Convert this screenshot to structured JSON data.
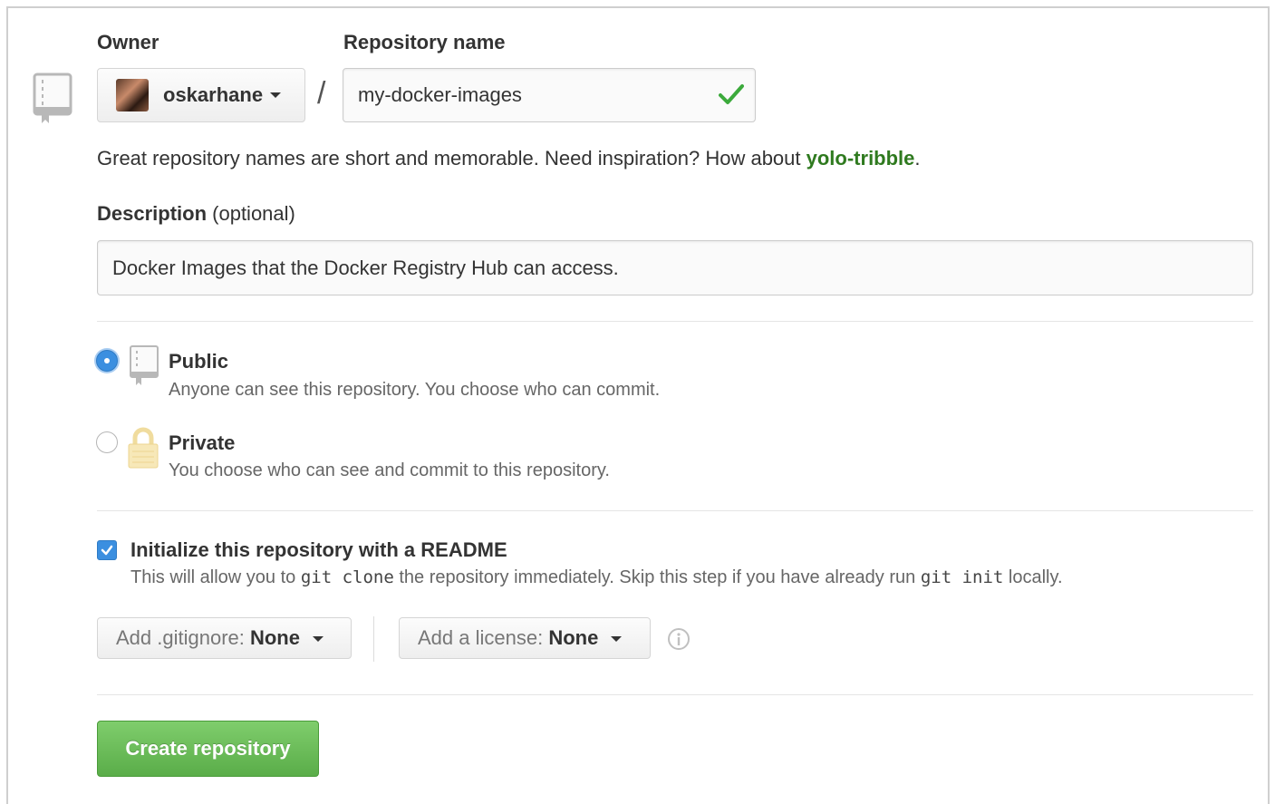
{
  "owner": {
    "label": "Owner",
    "name": "oskarhane",
    "avatar_icon": "user-avatar"
  },
  "repository": {
    "label": "Repository name",
    "separator": "/",
    "value": "my-docker-images",
    "valid_icon": "check-icon"
  },
  "hint": {
    "text": "Great repository names are short and memorable. Need inspiration? How about ",
    "suggestion": "yolo-tribble",
    "end": "."
  },
  "description": {
    "label": "Description",
    "optional": " (optional)",
    "value": "Docker Images that the Docker Registry Hub can access."
  },
  "visibility": {
    "selected": "Public",
    "public": {
      "title": "Public",
      "desc": "Anyone can see this repository. You choose who can commit."
    },
    "private": {
      "title": "Private",
      "desc": "You choose who can see and commit to this repository."
    }
  },
  "readme": {
    "checked": true,
    "title": "Initialize this repository with a README",
    "desc_1": "This will allow you to ",
    "code_1": "git clone",
    "desc_2": " the repository immediately. Skip this step if you have already run ",
    "code_2": "git init",
    "desc_3": " locally."
  },
  "gitignore": {
    "label": "Add .gitignore: ",
    "value": "None"
  },
  "license": {
    "label": "Add a license: ",
    "value": "None"
  },
  "create_button": {
    "label": "Create repository"
  },
  "colors": {
    "accent_blue": "#3b8fe0",
    "success_green": "#5aad49",
    "suggestion_green": "#2f7a1f"
  }
}
